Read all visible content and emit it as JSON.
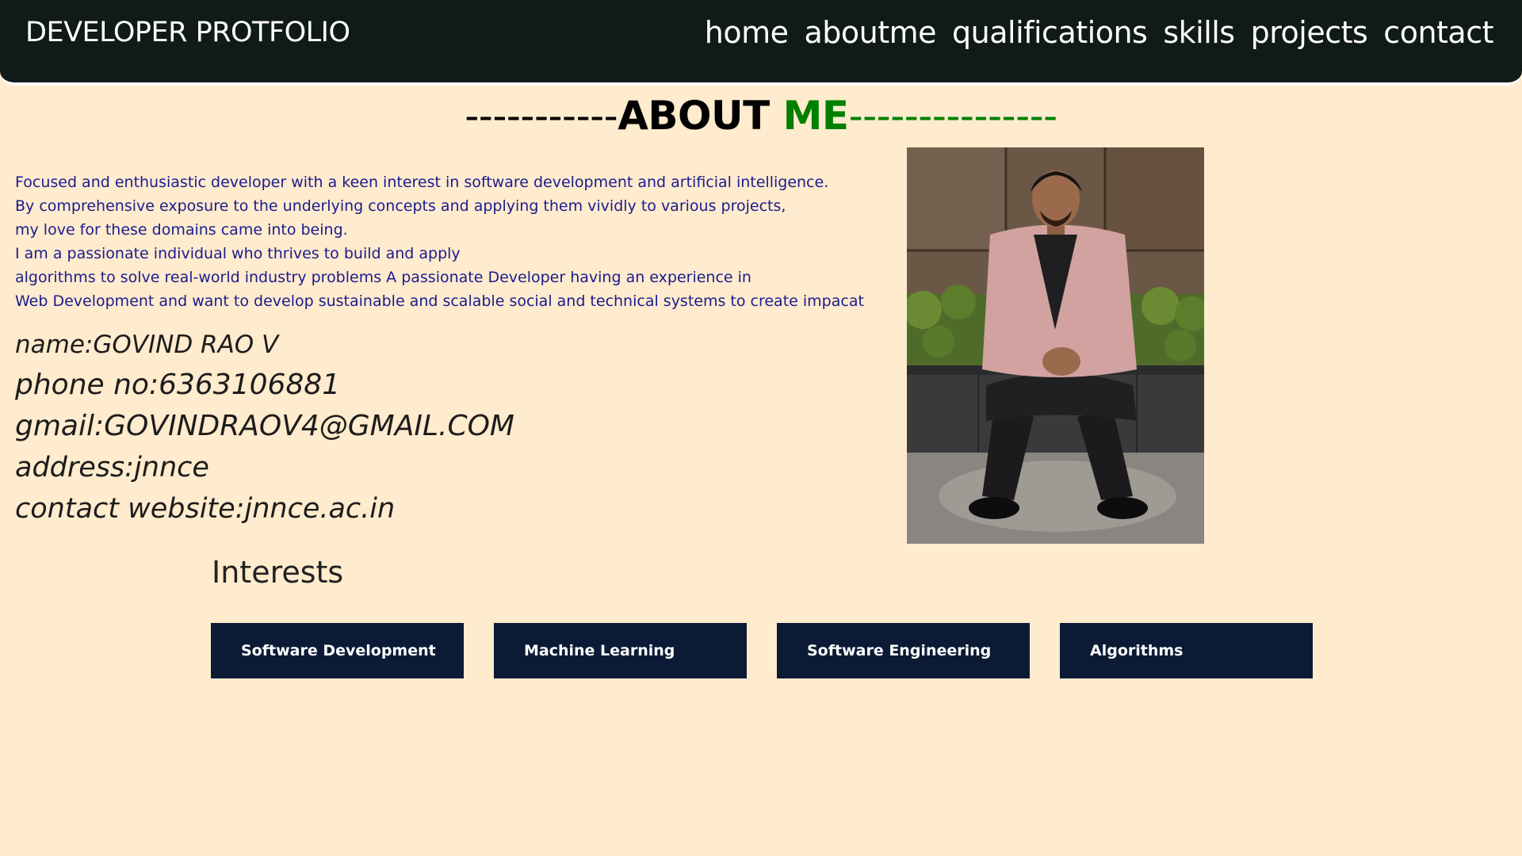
{
  "header": {
    "brand": "DEVELOPER PROTFOLIO",
    "nav": [
      "home",
      "aboutme",
      "qualifications",
      "skills",
      "projects",
      "contact"
    ]
  },
  "about": {
    "heading_left_dashes": "-----------",
    "heading_about": "ABOUT ",
    "heading_me": "ME",
    "heading_right_dashes": "---------------",
    "intro_lines": [
      "Focused and enthusiastic developer with a keen interest in software development and artificial intelligence.",
      "By comprehensive exposure to the underlying concepts and applying them vividly to various projects,",
      "my love for these domains came into being.",
      "I am a passionate individual who thrives to build and apply",
      "algorithms to solve real-world industry problems A passionate Developer having an experience in",
      "Web Development and want to develop sustainable and scalable social and technical systems to create impacat"
    ],
    "details": {
      "name": "name:GOVIND RAO V",
      "phone": "phone no:6363106881",
      "gmail": "gmail:GOVINDRAOV4@GMAIL.COM",
      "address": "address:jnnce",
      "website": "contact website:jnnce.ac.in"
    }
  },
  "interests": {
    "title": "Interests",
    "items": [
      "Software Development",
      "Machine Learning",
      "Software Engineering",
      "Algorithms"
    ]
  },
  "colors": {
    "background": "#ffebcd",
    "navbar": "#101a19",
    "accent_green": "#008000",
    "intro_text": "#1b1b8f",
    "interest_box": "#0b1b36"
  }
}
